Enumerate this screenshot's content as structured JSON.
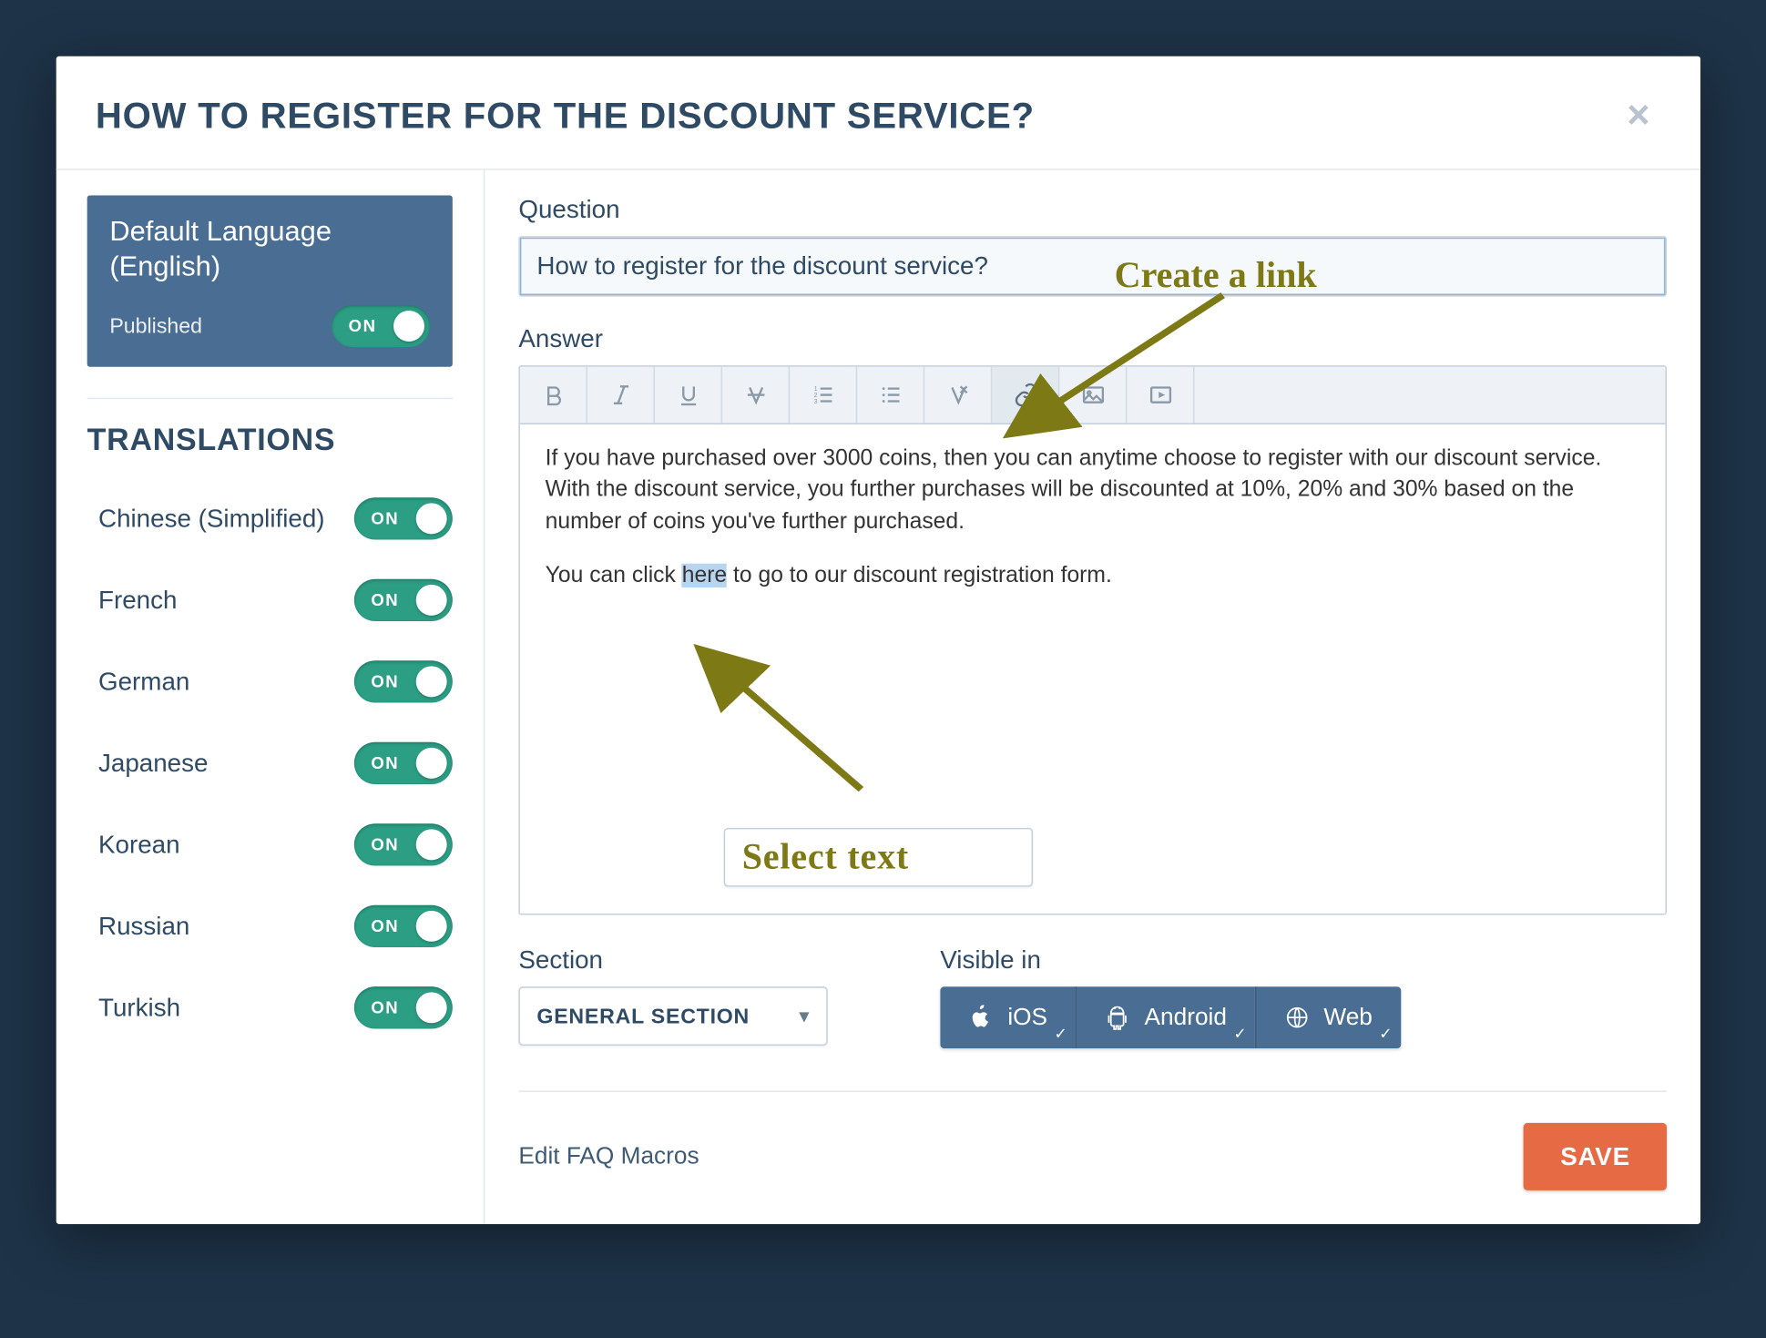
{
  "modal": {
    "title": "HOW TO REGISTER FOR THE DISCOUNT SERVICE?"
  },
  "sidebar": {
    "defaultLang": {
      "title": "Default Language (English)",
      "publishedLabel": "Published",
      "toggle": "ON"
    },
    "translationsHeading": "TRANSLATIONS",
    "languages": [
      {
        "name": "Chinese (Simplified)",
        "toggle": "ON"
      },
      {
        "name": "French",
        "toggle": "ON"
      },
      {
        "name": "German",
        "toggle": "ON"
      },
      {
        "name": "Japanese",
        "toggle": "ON"
      },
      {
        "name": "Korean",
        "toggle": "ON"
      },
      {
        "name": "Russian",
        "toggle": "ON"
      },
      {
        "name": "Turkish",
        "toggle": "ON"
      }
    ]
  },
  "main": {
    "questionLabel": "Question",
    "questionValue": "How to register for the discount service?",
    "answerLabel": "Answer",
    "answerP1": "If you have purchased over 3000 coins, then you can anytime choose to register with our discount service. With the discount service, you further purchases will be discounted at 10%, 20% and 30% based on the number of coins you've further purchased.",
    "answerP2a": "You can click ",
    "answerP2sel": "here",
    "answerP2b": " to go to our discount registration form.",
    "sectionLabel": "Section",
    "sectionValue": "GENERAL SECTION",
    "visibleLabel": "Visible in",
    "vis": {
      "ios": "iOS",
      "android": "Android",
      "web": "Web"
    },
    "macros": "Edit FAQ Macros",
    "save": "SAVE"
  },
  "annotations": {
    "createLink": "Create a link",
    "selectText": "Select text"
  }
}
